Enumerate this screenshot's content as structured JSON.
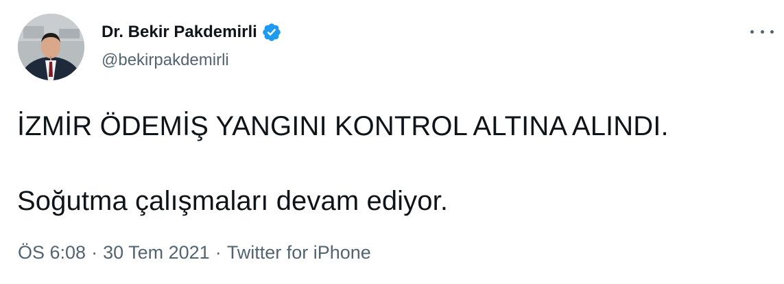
{
  "author": {
    "display_name": "Dr. Bekir Pakdemirli",
    "handle": "@bekirpakdemirli",
    "verified": true,
    "avatar_icon": "profile-photo",
    "verified_icon": "verified-badge-icon",
    "verified_color": "#1d9bf0"
  },
  "tweet": {
    "line1": "İZMİR ÖDEMİŞ YANGINI KONTROL ALTINA ALINDI.",
    "line2": "Soğutma çalışmaları devam ediyor."
  },
  "meta": {
    "time": "ÖS 6:08",
    "separator": "·",
    "date": "30 Tem 2021",
    "source": "Twitter for iPhone"
  },
  "menu": {
    "icon": "more-icon"
  },
  "colors": {
    "text_primary": "#0f1419",
    "text_secondary": "#536471",
    "accent": "#1d9bf0"
  }
}
